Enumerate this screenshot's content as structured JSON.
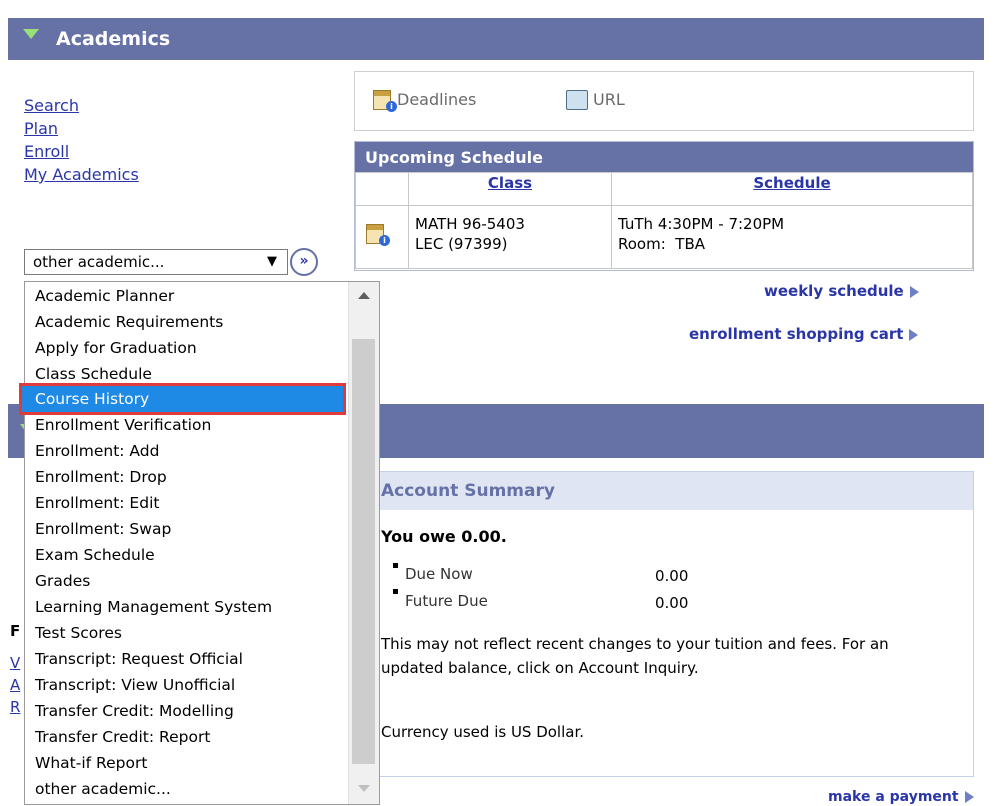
{
  "header": {
    "title": "Academics"
  },
  "section2": {
    "title": ""
  },
  "links": [
    "Search",
    "Plan",
    "Enroll",
    "My Academics"
  ],
  "select": {
    "value": "other academic...",
    "go_label": "»"
  },
  "dropdown": {
    "options": [
      "Academic Planner",
      "Academic Requirements",
      "Apply for Graduation",
      "Class Schedule",
      "Course History",
      "Enrollment Verification",
      "Enrollment: Add",
      "Enrollment: Drop",
      "Enrollment: Edit",
      "Enrollment: Swap",
      "Exam Schedule",
      "Grades",
      "Learning Management System",
      "Test Scores",
      "Transcript: Request Official",
      "Transcript: View Unofficial",
      "Transfer Credit: Modelling",
      "Transfer Credit: Report",
      "What-if Report",
      "other academic..."
    ],
    "selected": "Course History"
  },
  "quick_links": {
    "deadlines": "Deadlines",
    "url": "URL"
  },
  "schedule": {
    "title": "Upcoming Schedule",
    "col_class": "Class",
    "col_schedule": "Schedule",
    "row": {
      "class_line1": "MATH 96-5403",
      "class_line2": "LEC (97399)",
      "time": "TuTh 4:30PM - 7:20PM",
      "room": "Room:  TBA"
    }
  },
  "right_links": {
    "weekly": "weekly schedule",
    "cart": "enrollment shopping cart",
    "payment": "make a payment"
  },
  "account": {
    "title": "Account Summary",
    "owe": "You owe 0.00.",
    "due_now_label": "Due Now",
    "due_now_value": "0.00",
    "future_due_label": "Future Due",
    "future_due_value": "0.00",
    "note": "This may not reflect recent changes to your tuition and fees.  For an updated balance, click on Account Inquiry.",
    "currency": "Currency used is US Dollar."
  },
  "hidden_left": {
    "letter_f": "F",
    "letter_v": "V",
    "letter_a": "A",
    "letter_r": "R"
  }
}
